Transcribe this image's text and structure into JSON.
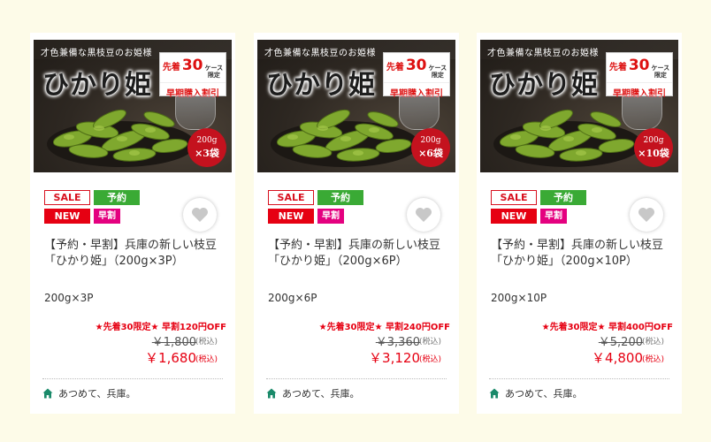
{
  "products": [
    {
      "image": {
        "catchcopy": "才色兼備な黒枝豆のお姫様",
        "brand": "ひかり姫",
        "promo_prefix": "先着",
        "promo_count": "30",
        "promo_unit": "ケース",
        "promo_limited": "限定",
        "promo_line2": "早期購入割引",
        "qty_weight": "200g",
        "qty_count": "×3袋"
      },
      "badges": {
        "sale": "SALE",
        "reservation": "予約",
        "new": "NEW",
        "early": "早割"
      },
      "name": "【予約・早割】兵庫の新しい枝豆「ひかり姫」（200g×3P）",
      "variant": "200g×3P",
      "offer": "★先着30限定★ 早割120円OFF",
      "original_price": "￥1,800",
      "price": "￥1,680",
      "tax_label": "(税込)",
      "shop": "あつめて、兵庫。"
    },
    {
      "image": {
        "catchcopy": "才色兼備な黒枝豆のお姫様",
        "brand": "ひかり姫",
        "promo_prefix": "先着",
        "promo_count": "30",
        "promo_unit": "ケース",
        "promo_limited": "限定",
        "promo_line2": "早期購入割引",
        "qty_weight": "200g",
        "qty_count": "×6袋"
      },
      "badges": {
        "sale": "SALE",
        "reservation": "予約",
        "new": "NEW",
        "early": "早割"
      },
      "name": "【予約・早割】兵庫の新しい枝豆「ひかり姫」（200g×6P）",
      "variant": "200g×6P",
      "offer": "★先着30限定★ 早割240円OFF",
      "original_price": "￥3,360",
      "price": "￥3,120",
      "tax_label": "(税込)",
      "shop": "あつめて、兵庫。"
    },
    {
      "image": {
        "catchcopy": "才色兼備な黒枝豆のお姫様",
        "brand": "ひかり姫",
        "promo_prefix": "先着",
        "promo_count": "30",
        "promo_unit": "ケース",
        "promo_limited": "限定",
        "promo_line2": "早期購入割引",
        "qty_weight": "200g",
        "qty_count": "×10袋"
      },
      "badges": {
        "sale": "SALE",
        "reservation": "予約",
        "new": "NEW",
        "early": "早割"
      },
      "name": "【予約・早割】兵庫の新しい枝豆「ひかり姫」（200g×10P）",
      "variant": "200g×10P",
      "offer": "★先着30限定★ 早割400円OFF",
      "original_price": "￥5,200",
      "price": "￥4,800",
      "tax_label": "(税込)",
      "shop": "あつめて、兵庫。"
    }
  ],
  "icons": {
    "favorite": "heart-icon",
    "shop": "home-icon"
  },
  "colors": {
    "background": "#fdfbe8",
    "sale_red": "#e60012",
    "reservation_green": "#3aaa35",
    "early_pink": "#e4007f",
    "shop_icon": "#1a8a6a"
  }
}
